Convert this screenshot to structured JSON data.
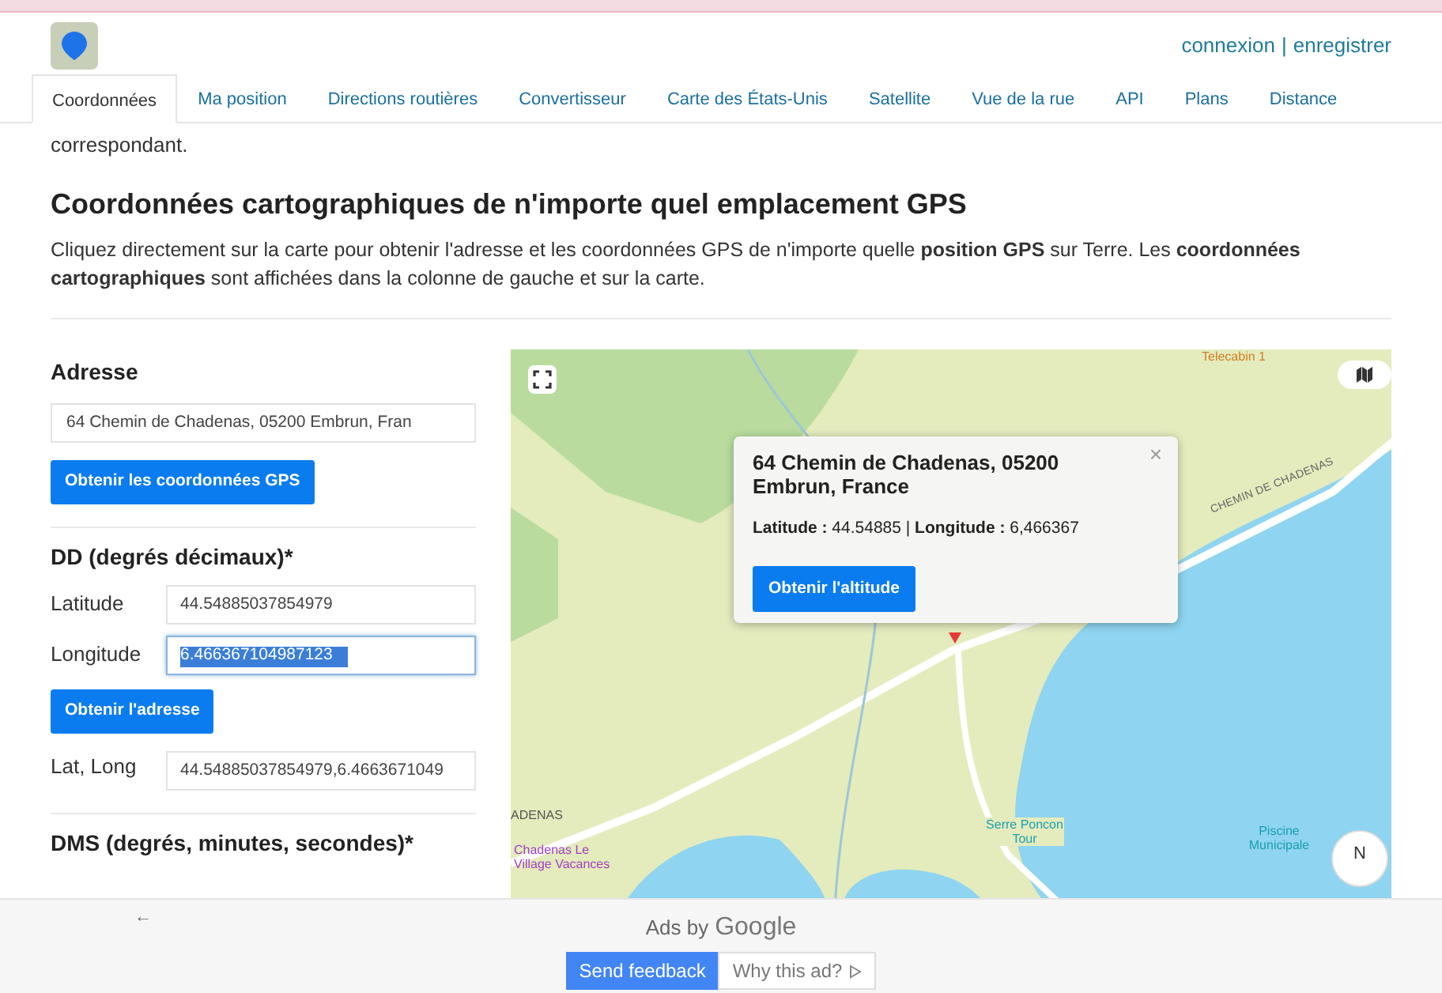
{
  "header": {
    "links": [
      "connexion",
      "enregistrer"
    ],
    "separator": "|"
  },
  "tabs": [
    {
      "label": "Coordonnées",
      "selected": true
    },
    {
      "label": "Ma position",
      "selected": false
    },
    {
      "label": "Directions routières",
      "selected": false
    },
    {
      "label": "Convertisseur",
      "selected": false
    },
    {
      "label": "Carte des États-Unis",
      "selected": false
    },
    {
      "label": "Satellite",
      "selected": false
    },
    {
      "label": "Vue de la rue",
      "selected": false
    },
    {
      "label": "API",
      "selected": false
    },
    {
      "label": "Plans",
      "selected": false
    },
    {
      "label": "Distance",
      "selected": false
    }
  ],
  "intro_fragment": "correspondant.",
  "heading": "Coordonnées cartographiques de n'importe quel emplacement GPS",
  "description": "Cliquez directement sur la carte pour obtenir l'adresse et les coordonnées GPS de n'importe quelle **position GPS** sur Terre. Les **coordonnées cartographiques** sont affichées dans la colonne de gauche et sur la carte.",
  "form": {
    "address_label": "Adresse",
    "address_value": "64 Chemin de Chadenas, 05200 Embrun, Fran",
    "get_gps_button": "Obtenir les coordonnées GPS",
    "dd_heading": "DD (degrés décimaux)*",
    "fields": [
      {
        "label": "Latitude",
        "value": "44.54885037854979",
        "focused": false
      },
      {
        "label": "Longitude",
        "value": "6.466367104987123",
        "focused": true
      }
    ],
    "get_address_button": "Obtenir l'adresse",
    "latlong_label": "Lat, Long",
    "latlong_value": "44.54885037854979,6.4663671049",
    "dms_heading": "DMS (degrés, minutes, secondes)*"
  },
  "map": {
    "labels": [
      {
        "text": "Telecabin 1",
        "kind": "poi"
      },
      {
        "text": "CHEMIN DE CHADENAS",
        "kind": "road"
      },
      {
        "text": "ADENAS",
        "kind": "area"
      },
      {
        "text": "Chadenas Le Village Vacances",
        "kind": "place"
      },
      {
        "text": "Serre Poncon Tour",
        "kind": "poi"
      },
      {
        "text": "Piscine Municipale",
        "kind": "poi"
      }
    ],
    "compass": "N",
    "popup": {
      "title": "64 Chemin de Chadenas, 05200 Embrun, France",
      "lat_label": "Latitude :",
      "lat": "44.54885",
      "separator": "|",
      "lon_label": "Longitude :",
      "lon": "6,466367",
      "button": "Obtenir l'altitude",
      "close": "×"
    }
  },
  "ads": {
    "label": "Ads by",
    "brand": "Google",
    "back": "←",
    "feedback_button": "Send feedback",
    "why_button": "Why this ad?"
  }
}
